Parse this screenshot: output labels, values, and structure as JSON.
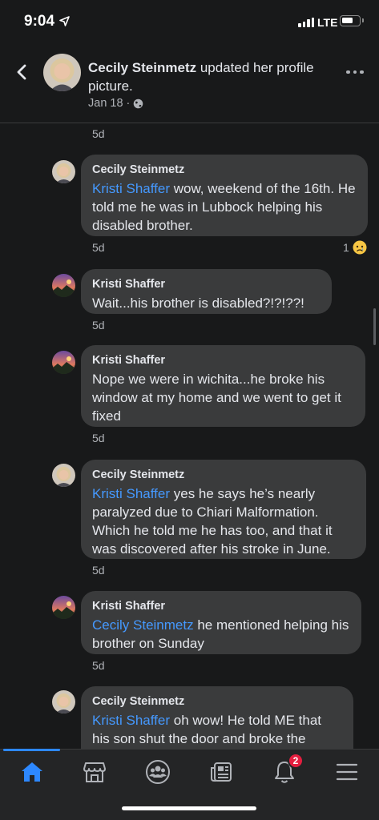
{
  "status": {
    "time": "9:04",
    "network": "LTE"
  },
  "post": {
    "author": "Cecily Steinmetz",
    "action": "updated her profile picture.",
    "date": "Jan 18",
    "separator": "·"
  },
  "comments": [
    {
      "author": "Cecily Steinmetz",
      "mention": "Kristi Shaffer",
      "text": " wow, weekend of the 16th. He told me he was in Lubbock helping his disabled brother.",
      "time": "5d",
      "reaction_count": "1",
      "reaction": "sad"
    },
    {
      "author": "Kristi Shaffer",
      "mention": "",
      "text": "Wait...his brother is disabled?!?!??!",
      "time": "5d"
    },
    {
      "author": "Kristi Shaffer",
      "mention": "",
      "text": "Nope we were in wichita...he broke his window at my home and we went to get it fixed",
      "time": "5d"
    },
    {
      "author": "Cecily Steinmetz",
      "mention": "Kristi Shaffer",
      "text": " yes he says he’s nearly paralyzed due to Chiari Malformation. Which he told me he has too, and that it was discovered after his stroke in June.",
      "time": "5d"
    },
    {
      "author": "Kristi Shaffer",
      "mention": "Cecily Steinmetz",
      "text": " he mentioned helping his brother on Sunday",
      "time": "5d"
    },
    {
      "author": "Cecily Steinmetz",
      "mention": "Kristi Shaffer",
      "text": " oh wow! He told ME that his son shut the door and broke the",
      "time": ""
    }
  ],
  "top_time": "5d",
  "tabs": [
    {
      "icon": "home-icon",
      "active": true
    },
    {
      "icon": "marketplace-icon",
      "active": false
    },
    {
      "icon": "groups-icon",
      "active": false
    },
    {
      "icon": "news-icon",
      "active": false
    },
    {
      "icon": "notifications-icon",
      "active": false,
      "badge": "2"
    },
    {
      "icon": "menu-icon",
      "active": false
    }
  ],
  "colors": {
    "background": "#18191a",
    "bubble": "#3a3b3c",
    "mention": "#4599ff",
    "accent": "#2d88ff",
    "badge": "#e41e3f"
  }
}
